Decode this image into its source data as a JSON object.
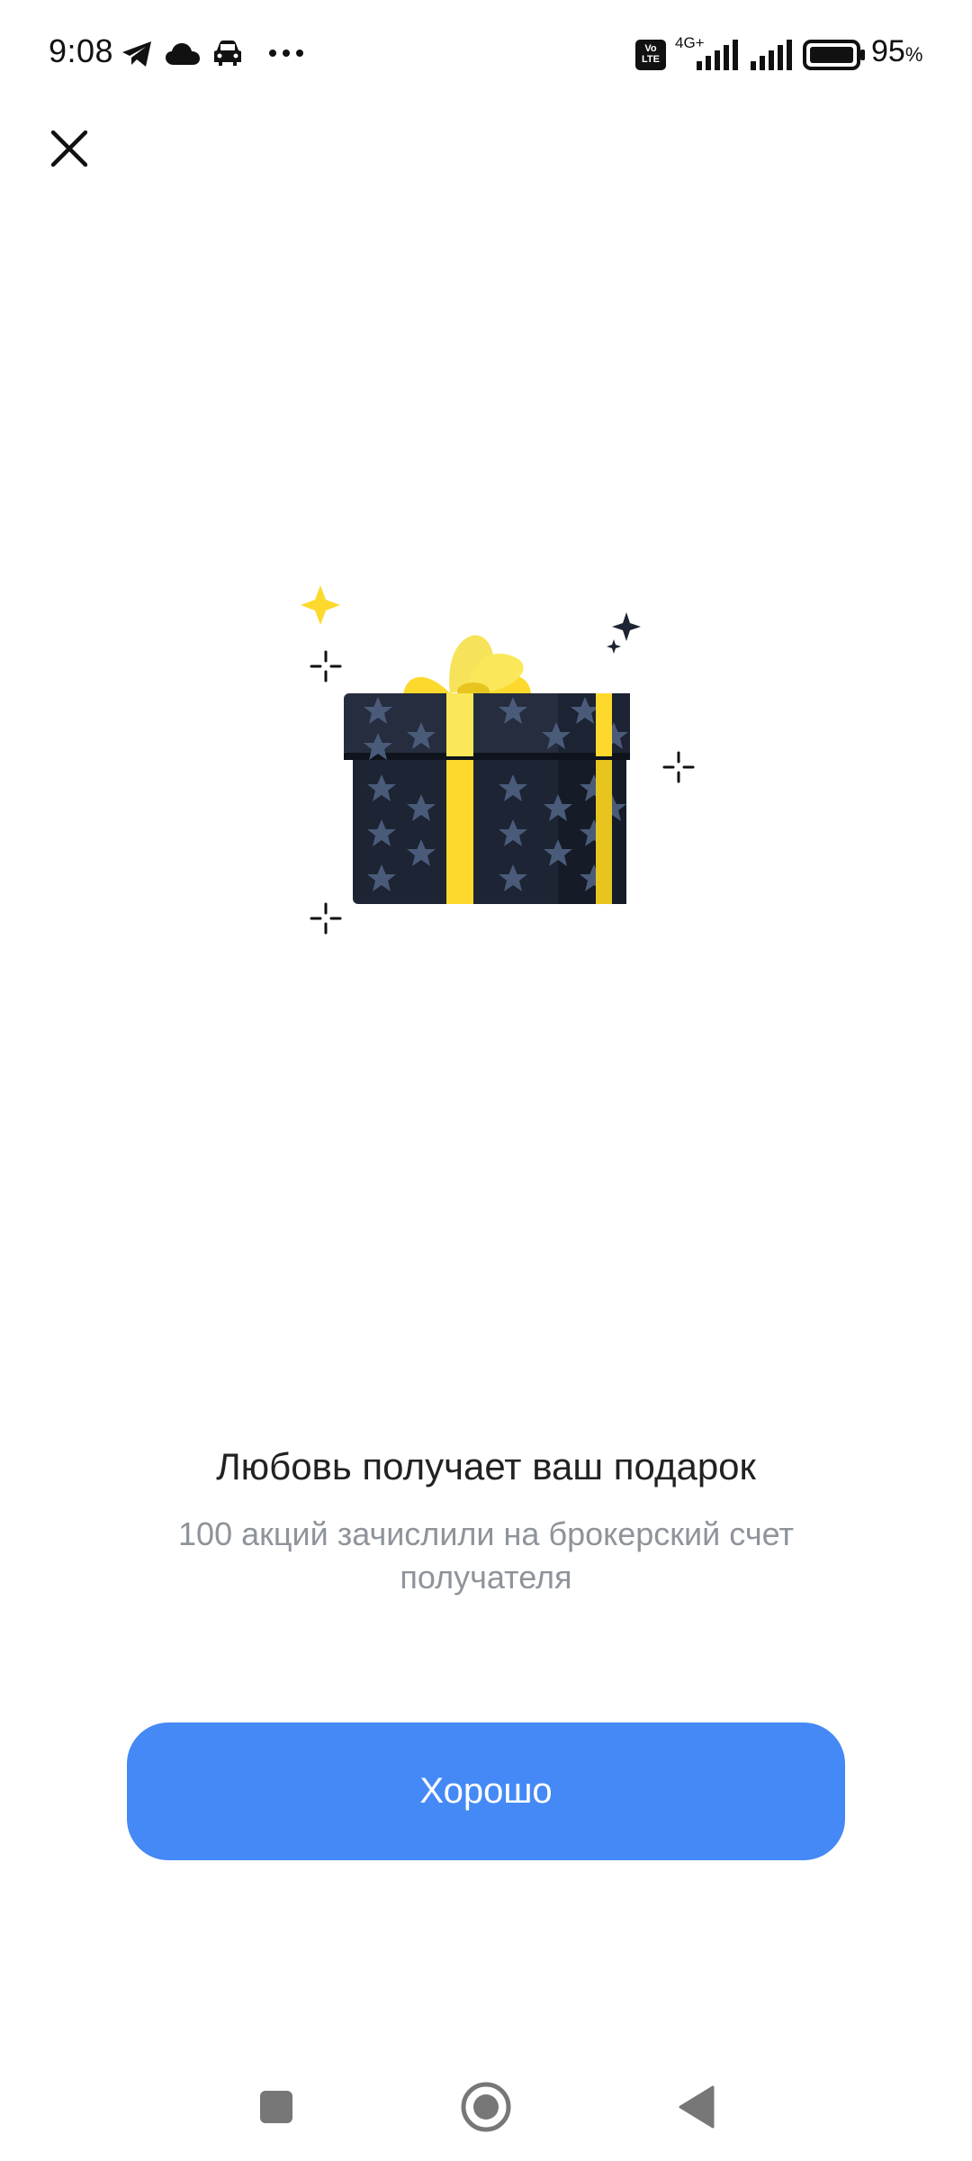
{
  "status_bar": {
    "time": "9:08",
    "icons": [
      "telegram-icon",
      "cloud-icon",
      "car-icon",
      "more-dots-icon",
      "volte-icon",
      "signal-4g-icon",
      "signal-icon",
      "battery-icon"
    ],
    "network_label": "4G+",
    "volte_label": "Vo LTE",
    "battery_value": "95",
    "battery_unit": "%"
  },
  "dialog": {
    "close_icon": "close-icon",
    "illustration": "gift-box-illustration",
    "title": "Любовь получает ваш подарок",
    "subtitle": "100 акций зачислили на брокерский счет получателя",
    "ok_button": "Хорошо"
  },
  "colors": {
    "accent": "#4489f6",
    "subtitle": "#8e949b",
    "gift_dark": "#1d2433",
    "ribbon": "#fcd92c"
  },
  "nav_bar": {
    "buttons": [
      "recents-square-icon",
      "home-circle-icon",
      "back-triangle-icon"
    ]
  }
}
